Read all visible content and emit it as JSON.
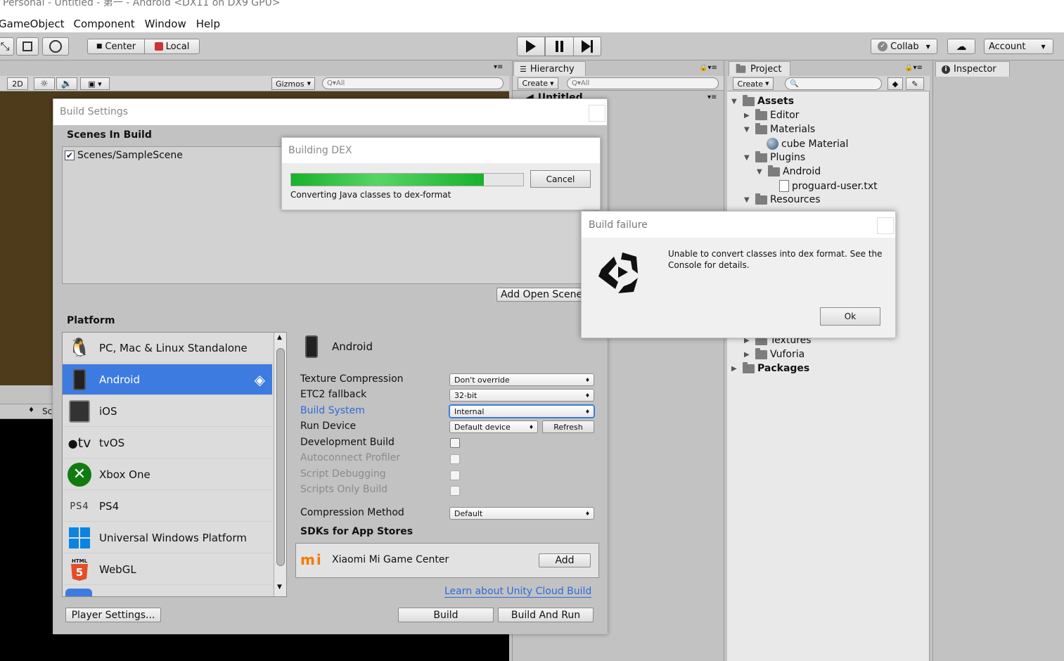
{
  "window_title": "Personal - Untitled - 第一 - Android <DX11 on DX9 GPU>",
  "menu": [
    "GameObject",
    "Component",
    "Window",
    "Help"
  ],
  "toolbar": {
    "center": "Center",
    "local": "Local",
    "collab": "Collab",
    "account": "Account"
  },
  "scene_bar": {
    "mode_2d": "2D",
    "gizmos": "Gizmos",
    "search": "All"
  },
  "hierarchy": {
    "tab": "Hierarchy",
    "create": "Create",
    "search": "All",
    "scene": "Untitled"
  },
  "project": {
    "tab": "Project",
    "create": "Create",
    "tree": [
      {
        "label": "Assets",
        "bold": true,
        "level": 0,
        "expanded": true
      },
      {
        "label": "Editor",
        "level": 1,
        "expanded": false
      },
      {
        "label": "Materials",
        "level": 1,
        "expanded": true
      },
      {
        "label": "cube Material",
        "level": 2,
        "kind": "material"
      },
      {
        "label": "Plugins",
        "level": 1,
        "expanded": true
      },
      {
        "label": "Android",
        "level": 2,
        "expanded": true
      },
      {
        "label": "proguard-user.txt",
        "level": 3,
        "kind": "file"
      },
      {
        "label": "Resources",
        "level": 1,
        "expanded": true
      },
      {
        "label": "Textures",
        "level": 1,
        "expanded": false
      },
      {
        "label": "Vuforia",
        "level": 1,
        "expanded": false
      },
      {
        "label": "Packages",
        "bold": true,
        "level": 0,
        "expanded": false
      }
    ]
  },
  "inspector": {
    "tab": "Inspector"
  },
  "lower_scene_tab": "Sc",
  "build_settings": {
    "title": "Build Settings",
    "scenes_header": "Scenes In Build",
    "scene_item": "Scenes/SampleScene",
    "add_open_scenes": "Add Open Scenes",
    "platform_header": "Platform",
    "platforms": [
      "PC, Mac & Linux Standalone",
      "Android",
      "iOS",
      "tvOS",
      "Xbox One",
      "PS4",
      "Universal Windows Platform",
      "WebGL"
    ],
    "ios_tv_prefix": "tv",
    "ps4_logo": "PS4",
    "webgl_logo": "HTML",
    "selected_platform": "Android",
    "settings": {
      "texture_compression": {
        "label": "Texture Compression",
        "value": "Don't override"
      },
      "etc2_fallback": {
        "label": "ETC2 fallback",
        "value": "32-bit"
      },
      "build_system": {
        "label": "Build System",
        "value": "Internal"
      },
      "run_device": {
        "label": "Run Device",
        "value": "Default device",
        "refresh": "Refresh"
      },
      "development_build": "Development Build",
      "autoconnect_profiler": "Autoconnect Profiler",
      "script_debugging": "Script Debugging",
      "scripts_only_build": "Scripts Only Build",
      "compression_method": {
        "label": "Compression Method",
        "value": "Default"
      }
    },
    "sdks_header": "SDKs for App Stores",
    "sdk_item": "Xiaomi Mi Game Center",
    "sdk_add": "Add",
    "sdk_logo": "mi",
    "cloud_link": "Learn about Unity Cloud Build",
    "player_settings": "Player Settings...",
    "build": "Build",
    "build_and_run": "Build And Run"
  },
  "building_dex": {
    "title": "Building DEX",
    "message": "Converting Java classes to dex-format",
    "cancel": "Cancel",
    "progress": 0.83
  },
  "build_failure": {
    "title": "Build failure",
    "message": "Unable to convert classes into dex format. See the Console for details.",
    "ok": "Ok"
  },
  "colors": {
    "accent": "#3d7be0",
    "progress": "#17b22b",
    "link": "#2e6ad8",
    "scene_bg": "#4e3b1c"
  }
}
